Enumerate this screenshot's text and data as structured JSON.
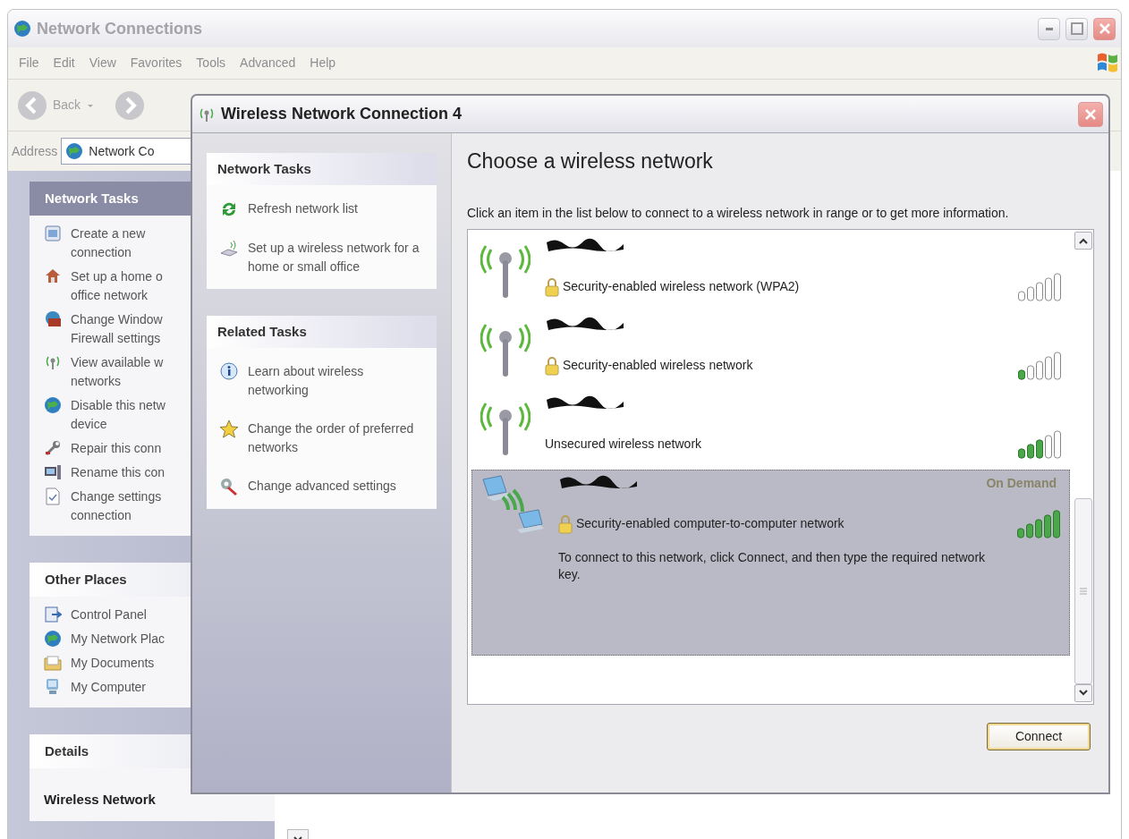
{
  "window": {
    "title": "Network Connections"
  },
  "menu": [
    "File",
    "Edit",
    "View",
    "Favorites",
    "Tools",
    "Advanced",
    "Help"
  ],
  "toolbar": {
    "back": "Back"
  },
  "address": {
    "label": "Address",
    "value": "Network Co"
  },
  "task_pane": {
    "sections": [
      {
        "title": "Network Tasks",
        "kind": "special",
        "items": [
          {
            "lines": [
              "Create a new",
              "connection"
            ]
          },
          {
            "lines": [
              "Set up a home o",
              "office network"
            ]
          },
          {
            "lines": [
              "Change Window",
              "Firewall settings"
            ]
          },
          {
            "lines": [
              "View available w",
              "networks"
            ]
          },
          {
            "lines": [
              "Disable this netw",
              "device"
            ]
          },
          {
            "lines": [
              "Repair this conn"
            ]
          },
          {
            "lines": [
              "Rename this con"
            ]
          },
          {
            "lines": [
              "Change settings",
              "connection"
            ]
          }
        ]
      },
      {
        "title": "Other Places",
        "kind": "normal",
        "items": [
          {
            "lines": [
              "Control Panel"
            ]
          },
          {
            "lines": [
              "My Network Plac"
            ]
          },
          {
            "lines": [
              "My Documents"
            ]
          },
          {
            "lines": [
              "My Computer"
            ]
          }
        ]
      },
      {
        "title": "Details",
        "kind": "details",
        "items": [
          {
            "lines": [
              "Wireless Network"
            ]
          }
        ]
      }
    ]
  },
  "dialog": {
    "title": "Wireless Network Connection 4",
    "sections": [
      {
        "title": "Network Tasks",
        "items": [
          "Refresh network list",
          "Set up a wireless network for a home or small office"
        ]
      },
      {
        "title": "Related Tasks",
        "items": [
          "Learn about wireless networking",
          "Change the order of preferred networks",
          "Change advanced settings"
        ]
      }
    ],
    "heading": "Choose a wireless network",
    "description": "Click an item in the list below to connect to a wireless network in range or to get more information.",
    "networks": [
      {
        "kind": "access_point",
        "secured": true,
        "security": "Security-enabled wireless network (WPA2)",
        "level": 0,
        "selected": false
      },
      {
        "kind": "access_point",
        "secured": true,
        "security": "Security-enabled wireless network",
        "level": 0.2,
        "selected": false
      },
      {
        "kind": "access_point",
        "secured": false,
        "security": "Unsecured wireless network",
        "level": 0.6,
        "selected": false
      },
      {
        "kind": "computer_to_computer",
        "secured": true,
        "security": "Security-enabled computer-to-computer network",
        "level": 1,
        "selected": true,
        "status": "On Demand",
        "message": "To connect to this network, click Connect, and then type the required network key."
      }
    ],
    "button": "Connect"
  }
}
